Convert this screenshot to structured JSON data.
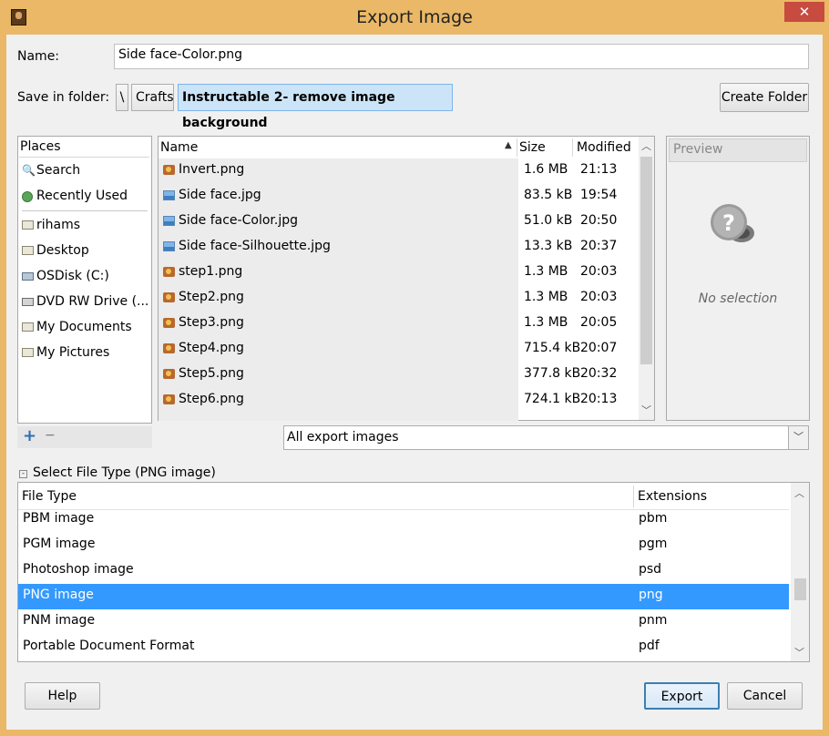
{
  "window": {
    "title": "Export Image",
    "close_glyph": "✕"
  },
  "name_row": {
    "label": "Name:",
    "value": "Side face-Color.png"
  },
  "folder_row": {
    "label": "Save in folder:",
    "crumbs": [
      "\\",
      "Crafts",
      "Instructable 2- remove image background"
    ],
    "create_folder": "Create Folder"
  },
  "places": {
    "header": "Places",
    "items": [
      {
        "label": "Search",
        "icon": "search-icon"
      },
      {
        "label": "Recently Used",
        "icon": "recent-icon"
      },
      {
        "label": "rihams",
        "icon": "folder-icon"
      },
      {
        "label": "Desktop",
        "icon": "folder-icon"
      },
      {
        "label": "OSDisk (C:)",
        "icon": "disk-icon"
      },
      {
        "label": "DVD RW Drive (...",
        "icon": "dvd-icon"
      },
      {
        "label": "My Documents",
        "icon": "folder-icon"
      },
      {
        "label": "My Pictures",
        "icon": "folder-icon"
      }
    ],
    "add_glyph": "+",
    "remove_glyph": "−"
  },
  "files": {
    "columns": {
      "name": "Name",
      "size": "Size",
      "modified": "Modified"
    },
    "rows": [
      {
        "name": "Invert.png",
        "size": "1.6 MB",
        "modified": "21:13",
        "type": "png"
      },
      {
        "name": "Side face.jpg",
        "size": "83.5 kB",
        "modified": "19:54",
        "type": "jpg"
      },
      {
        "name": "Side face-Color.jpg",
        "size": "51.0 kB",
        "modified": "20:50",
        "type": "jpg"
      },
      {
        "name": "Side face-Silhouette.jpg",
        "size": "13.3 kB",
        "modified": "20:37",
        "type": "jpg"
      },
      {
        "name": "step1.png",
        "size": "1.3 MB",
        "modified": "20:03",
        "type": "png"
      },
      {
        "name": "Step2.png",
        "size": "1.3 MB",
        "modified": "20:03",
        "type": "png"
      },
      {
        "name": "Step3.png",
        "size": "1.3 MB",
        "modified": "20:05",
        "type": "png"
      },
      {
        "name": "Step4.png",
        "size": "715.4 kB",
        "modified": "20:07",
        "type": "png"
      },
      {
        "name": "Step5.png",
        "size": "377.8 kB",
        "modified": "20:32",
        "type": "png"
      },
      {
        "name": "Step6.png",
        "size": "724.1 kB",
        "modified": "20:13",
        "type": "png"
      }
    ]
  },
  "preview": {
    "header": "Preview",
    "empty_text": "No selection"
  },
  "filter": {
    "value": "All export images"
  },
  "file_type": {
    "expander_label": "Select File Type (PNG image)",
    "columns": {
      "type": "File Type",
      "ext": "Extensions"
    },
    "rows": [
      {
        "type": "PBM image",
        "ext": "pbm"
      },
      {
        "type": "PGM image",
        "ext": "pgm"
      },
      {
        "type": "Photoshop image",
        "ext": "psd"
      },
      {
        "type": "PNG image",
        "ext": "png",
        "selected": true
      },
      {
        "type": "PNM image",
        "ext": "pnm"
      },
      {
        "type": "Portable Document Format",
        "ext": "pdf"
      }
    ]
  },
  "buttons": {
    "help": "Help",
    "export": "Export",
    "cancel": "Cancel"
  },
  "colors": {
    "frame": "#eab866",
    "selection": "#3399ff",
    "close": "#c74b3f"
  }
}
